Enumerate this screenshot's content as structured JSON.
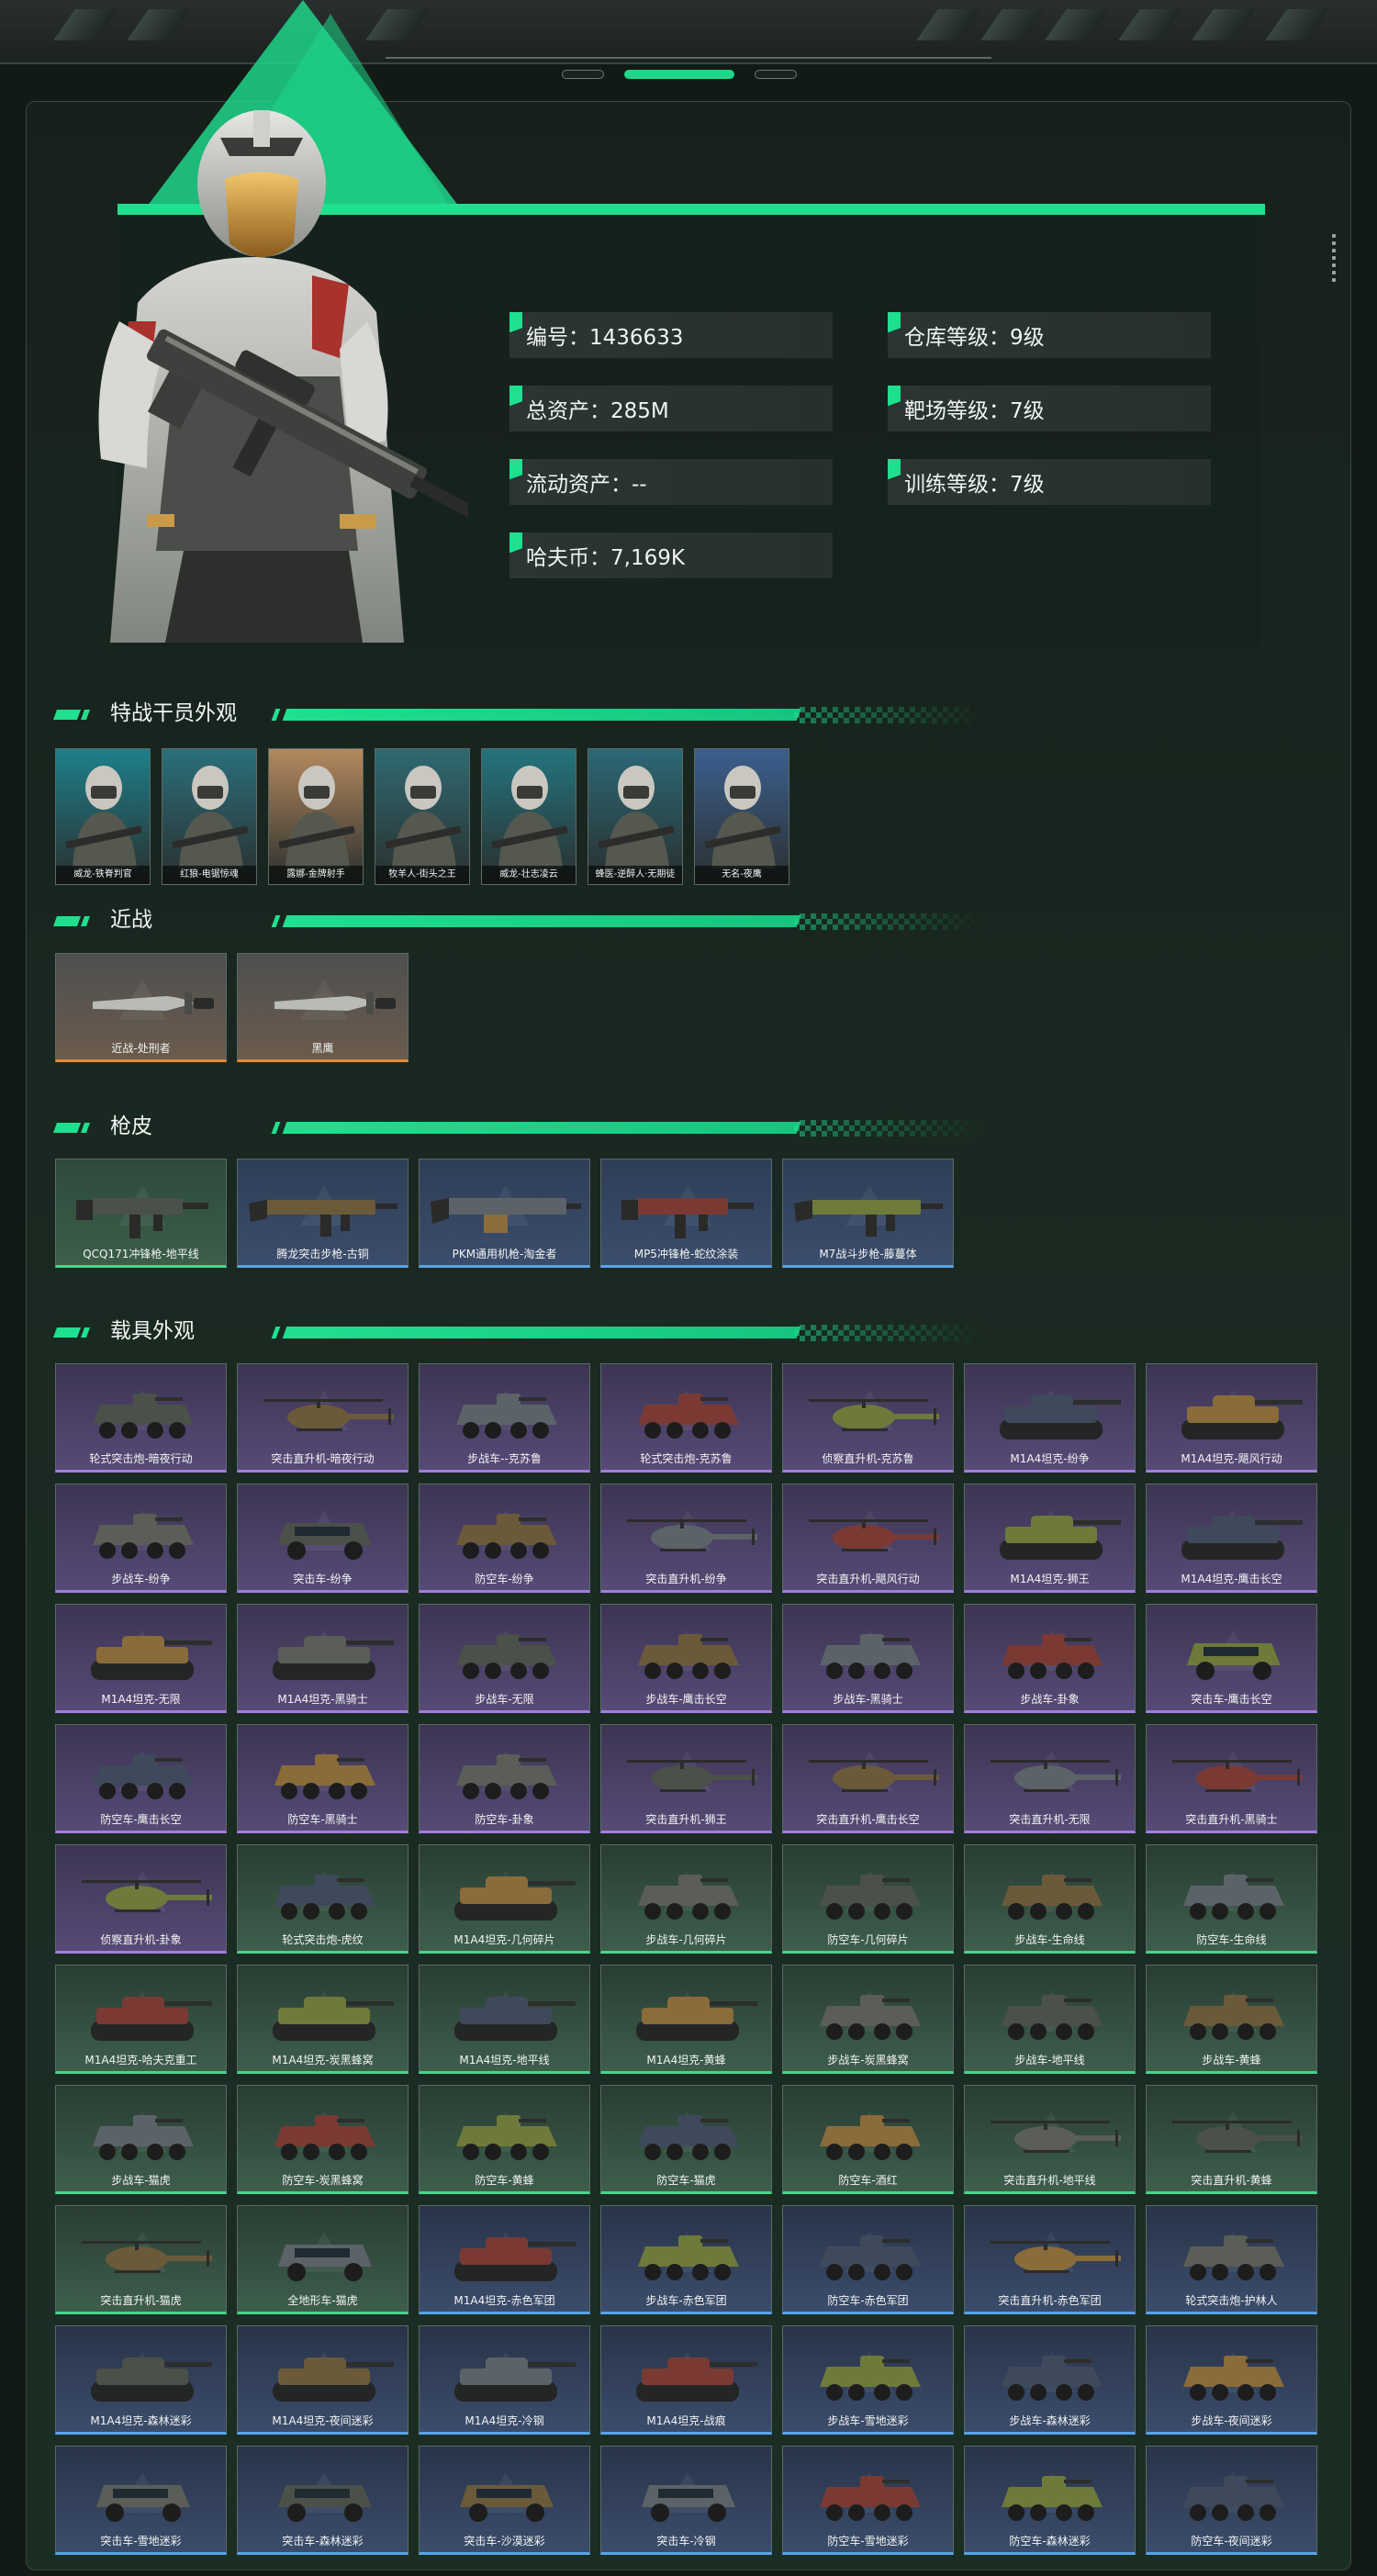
{
  "colors": {
    "accent": "#1fe08f",
    "melee_border": "#e38a3a",
    "green_border": "#4bd38c",
    "blue_border": "#5aa2e8",
    "purple_border": "#a47de0"
  },
  "stats": [
    {
      "label": "编号：1436633"
    },
    {
      "label": "仓库等级：9级"
    },
    {
      "label": "总资产：285M"
    },
    {
      "label": "靶场等级：7级"
    },
    {
      "label": "流动资产：--"
    },
    {
      "label": "训练等级：7级"
    },
    {
      "label": "哈夫币：7,169K"
    }
  ],
  "sections": {
    "operators": "特战干员外观",
    "melee": "近战",
    "gun_skins": "枪皮",
    "vehicles": "载具外观"
  },
  "operator_skins": [
    "威龙-铁脊判官",
    "红狼-电锯惊魂",
    "露娜-金牌射手",
    "牧羊人-街头之王",
    "威龙-壮志凌云",
    "蜂医-逆醉人·无期徒",
    "无名-夜鹰"
  ],
  "melee_items": [
    {
      "name": "近战-处刑者",
      "icon": "knife-icon"
    },
    {
      "name": "黑鹰",
      "icon": "knife-icon"
    }
  ],
  "gun_skins": [
    {
      "name": "QCQ171冲锋枪-地平线",
      "rarity": "green",
      "icon": "smg-icon"
    },
    {
      "name": "腾龙突击步枪-古铜",
      "rarity": "blue",
      "icon": "rifle-icon"
    },
    {
      "name": "PKM通用机枪-淘金者",
      "rarity": "blue",
      "icon": "machine-gun-icon"
    },
    {
      "name": "MP5冲锋枪-蛇纹涂装",
      "rarity": "blue",
      "icon": "smg-icon"
    },
    {
      "name": "M7战斗步枪-藤蔓体",
      "rarity": "blue",
      "icon": "rifle-icon"
    }
  ],
  "vehicles": [
    {
      "name": "轮式突击炮-暗夜行动",
      "rarity": "purple",
      "type": "apc"
    },
    {
      "name": "突击直升机-暗夜行动",
      "rarity": "purple",
      "type": "heli"
    },
    {
      "name": "步战车--克苏鲁",
      "rarity": "purple",
      "type": "apc"
    },
    {
      "name": "轮式突击炮-克苏鲁",
      "rarity": "purple",
      "type": "apc"
    },
    {
      "name": "侦察直升机-克苏鲁",
      "rarity": "purple",
      "type": "heli"
    },
    {
      "name": "M1A4坦克-纷争",
      "rarity": "purple",
      "type": "tank"
    },
    {
      "name": "M1A4坦克-飓风行动",
      "rarity": "purple",
      "type": "tank"
    },
    {
      "name": "步战车-纷争",
      "rarity": "purple",
      "type": "apc"
    },
    {
      "name": "突击车-纷争",
      "rarity": "purple",
      "type": "car"
    },
    {
      "name": "防空车-纷争",
      "rarity": "purple",
      "type": "apc"
    },
    {
      "name": "突击直升机-纷争",
      "rarity": "purple",
      "type": "heli"
    },
    {
      "name": "突击直升机-飓风行动",
      "rarity": "purple",
      "type": "heli"
    },
    {
      "name": "M1A4坦克-狮王",
      "rarity": "purple",
      "type": "tank"
    },
    {
      "name": "M1A4坦克-鹰击长空",
      "rarity": "purple",
      "type": "tank"
    },
    {
      "name": "M1A4坦克-无限",
      "rarity": "purple",
      "type": "tank"
    },
    {
      "name": "M1A4坦克-黑骑士",
      "rarity": "purple",
      "type": "tank"
    },
    {
      "name": "步战车-无限",
      "rarity": "purple",
      "type": "apc"
    },
    {
      "name": "步战车-鹰击长空",
      "rarity": "purple",
      "type": "apc"
    },
    {
      "name": "步战车-黑骑士",
      "rarity": "purple",
      "type": "apc"
    },
    {
      "name": "步战车-卦象",
      "rarity": "purple",
      "type": "apc"
    },
    {
      "name": "突击车-鹰击长空",
      "rarity": "purple",
      "type": "car"
    },
    {
      "name": "防空车-鹰击长空",
      "rarity": "purple",
      "type": "apc"
    },
    {
      "name": "防空车-黑骑士",
      "rarity": "purple",
      "type": "apc"
    },
    {
      "name": "防空车-卦象",
      "rarity": "purple",
      "type": "apc"
    },
    {
      "name": "突击直升机-狮王",
      "rarity": "purple",
      "type": "heli"
    },
    {
      "name": "突击直升机-鹰击长空",
      "rarity": "purple",
      "type": "heli"
    },
    {
      "name": "突击直升机-无限",
      "rarity": "purple",
      "type": "heli"
    },
    {
      "name": "突击直升机-黑骑士",
      "rarity": "purple",
      "type": "heli"
    },
    {
      "name": "侦察直升机-卦象",
      "rarity": "purple",
      "type": "heli"
    },
    {
      "name": "轮式突击炮-虎纹",
      "rarity": "green",
      "type": "apc"
    },
    {
      "name": "M1A4坦克-几何碎片",
      "rarity": "green",
      "type": "tank"
    },
    {
      "name": "步战车-几何碎片",
      "rarity": "green",
      "type": "apc"
    },
    {
      "name": "防空车-几何碎片",
      "rarity": "green",
      "type": "apc"
    },
    {
      "name": "步战车-生命线",
      "rarity": "green",
      "type": "apc"
    },
    {
      "name": "防空车-生命线",
      "rarity": "green",
      "type": "apc"
    },
    {
      "name": "M1A4坦克-哈夫克重工",
      "rarity": "green",
      "type": "tank"
    },
    {
      "name": "M1A4坦克-炭黑蜂窝",
      "rarity": "green",
      "type": "tank"
    },
    {
      "name": "M1A4坦克-地平线",
      "rarity": "green",
      "type": "tank"
    },
    {
      "name": "M1A4坦克-黄蜂",
      "rarity": "green",
      "type": "tank"
    },
    {
      "name": "步战车-炭黑蜂窝",
      "rarity": "green",
      "type": "apc"
    },
    {
      "name": "步战车-地平线",
      "rarity": "green",
      "type": "apc"
    },
    {
      "name": "步战车-黄蜂",
      "rarity": "green",
      "type": "apc"
    },
    {
      "name": "步战车-猫虎",
      "rarity": "green",
      "type": "apc"
    },
    {
      "name": "防空车-炭黑蜂窝",
      "rarity": "green",
      "type": "apc"
    },
    {
      "name": "防空车-黄蜂",
      "rarity": "green",
      "type": "apc"
    },
    {
      "name": "防空车-猫虎",
      "rarity": "green",
      "type": "apc"
    },
    {
      "name": "防空车-酒红",
      "rarity": "green",
      "type": "apc"
    },
    {
      "name": "突击直升机-地平线",
      "rarity": "green",
      "type": "heli"
    },
    {
      "name": "突击直升机-黄蜂",
      "rarity": "green",
      "type": "heli"
    },
    {
      "name": "突击直升机-猫虎",
      "rarity": "green",
      "type": "heli"
    },
    {
      "name": "全地形车-猫虎",
      "rarity": "green",
      "type": "car"
    },
    {
      "name": "M1A4坦克-赤色军团",
      "rarity": "blue",
      "type": "tank"
    },
    {
      "name": "步战车-赤色军团",
      "rarity": "blue",
      "type": "apc"
    },
    {
      "name": "防空车-赤色军团",
      "rarity": "blue",
      "type": "apc"
    },
    {
      "name": "突击直升机-赤色军团",
      "rarity": "blue",
      "type": "heli"
    },
    {
      "name": "轮式突击炮-护林人",
      "rarity": "blue",
      "type": "apc"
    },
    {
      "name": "M1A4坦克-森林迷彩",
      "rarity": "blue",
      "type": "tank"
    },
    {
      "name": "M1A4坦克-夜间迷彩",
      "rarity": "blue",
      "type": "tank"
    },
    {
      "name": "M1A4坦克-冷钢",
      "rarity": "blue",
      "type": "tank"
    },
    {
      "name": "M1A4坦克-战痕",
      "rarity": "blue",
      "type": "tank"
    },
    {
      "name": "步战车-雪地迷彩",
      "rarity": "blue",
      "type": "apc"
    },
    {
      "name": "步战车-森林迷彩",
      "rarity": "blue",
      "type": "apc"
    },
    {
      "name": "步战车-夜间迷彩",
      "rarity": "blue",
      "type": "apc"
    },
    {
      "name": "突击车-雪地迷彩",
      "rarity": "blue",
      "type": "car"
    },
    {
      "name": "突击车-森林迷彩",
      "rarity": "blue",
      "type": "car"
    },
    {
      "name": "突击车-沙漠迷彩",
      "rarity": "blue",
      "type": "car"
    },
    {
      "name": "突击车-冷钢",
      "rarity": "blue",
      "type": "car"
    },
    {
      "name": "防空车-雪地迷彩",
      "rarity": "blue",
      "type": "apc"
    },
    {
      "name": "防空车-森林迷彩",
      "rarity": "blue",
      "type": "apc"
    },
    {
      "name": "防空车-夜间迷彩",
      "rarity": "blue",
      "type": "apc"
    }
  ]
}
